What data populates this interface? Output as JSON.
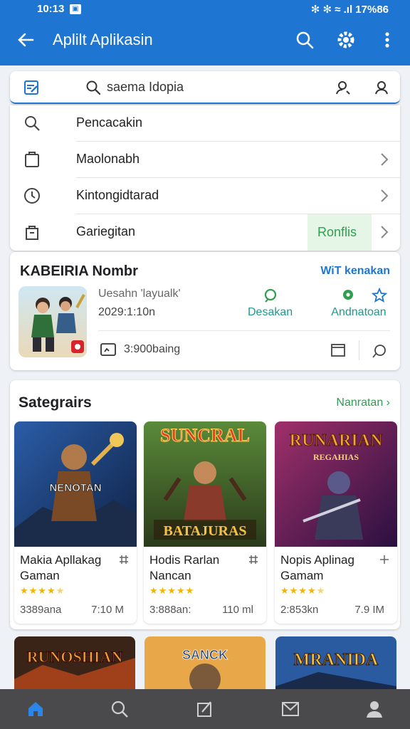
{
  "status_bar": {
    "time": "10:13",
    "right": "✻ ✻ ≈ .ıl 17%86"
  },
  "app_bar": {
    "title": "Aplilt Aplikasin"
  },
  "search": {
    "query": "saema Idopia"
  },
  "menu": {
    "items": [
      {
        "label": "Pencacakin",
        "icon": "search-icon"
      },
      {
        "label": "Maolonabh",
        "icon": "clipboard-icon"
      },
      {
        "label": "Kintongidtarad",
        "icon": "clock-icon"
      },
      {
        "label": "Gariegitan",
        "icon": "bag-icon",
        "badge": "Ronflis"
      }
    ]
  },
  "featured": {
    "title": "KABEIRIA Nombr",
    "link": "WiT kenakan",
    "line1": "Uesahn 'layualk'",
    "line2": "2029:1:10n",
    "actions": [
      {
        "label": "Desakan"
      },
      {
        "label": "Andnatoan"
      }
    ],
    "size": "3:900baing"
  },
  "games_section": {
    "title": "Sategrairs",
    "more": "Nanratan ›",
    "cards": [
      {
        "name": "Makia Apllakag Gaman",
        "art_text": "NENOTAN",
        "rating": 4.5,
        "downloads": "3389ana",
        "size": "7:10 M"
      },
      {
        "name": "Hodis Rarlan Nancan",
        "art_text_top": "SUNCRAL",
        "art_text": "BATAJURAS",
        "rating": 5,
        "downloads": "3:888an:",
        "size": "110 ml"
      },
      {
        "name": "Nopis Aplinag Gamam",
        "art_text_top": "RUNARIAN",
        "art_text": "REGAHIAS",
        "rating": 4.5,
        "downloads": "2:853kn",
        "size": "7.9 IM"
      }
    ],
    "row2": [
      {
        "art_text": "RUNOSHIAN"
      },
      {
        "art_text": "SANCK"
      },
      {
        "art_text": "MRANIDA"
      }
    ]
  },
  "colors": {
    "primary": "#1f76d2",
    "accent_green": "#2e9e4f",
    "star": "#f4b400",
    "nav_bg": "#4a4a4c"
  }
}
